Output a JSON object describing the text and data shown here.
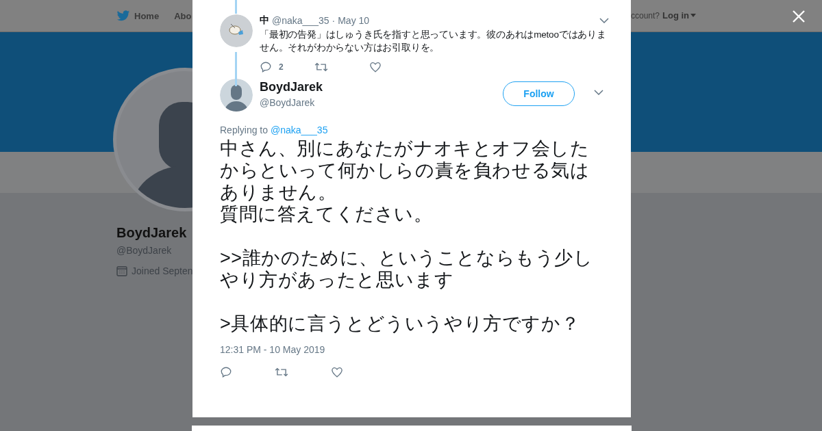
{
  "nav": {
    "links": [
      "Home",
      "Abo"
    ],
    "account_prompt": "ccount?",
    "login": "Log in"
  },
  "profile": {
    "name": "BoydJarek",
    "handle": "@BoydJarek",
    "joined": "Joined Septen"
  },
  "modal": {
    "parent_tweet": {
      "author": "中",
      "handle": "@naka___35",
      "separator": "·",
      "date": "May 10",
      "text": "「最初の告発」はしゅうき氏を指すと思っています。彼のあれはmetooではありません。それがわからない方はお引取りを。",
      "reply_count": "2"
    },
    "tweet": {
      "name": "BoydJarek",
      "handle": "@BoydJarek",
      "follow": "Follow",
      "replying_label": "Replying to",
      "replying_to": "@naka___35",
      "paragraphs": [
        [
          "中さん、別にあなたがナオキとオフ会した",
          "からといって何かしらの責を負わせる気は",
          "ありません。",
          "質問に答えてください。"
        ],
        [
          ">>誰かのために、ということならもう少し",
          "やり方があったと思います"
        ],
        [
          ">具体的に言うとどういうやり方ですか？"
        ]
      ],
      "timestamp": "12:31 PM - 10 May 2019"
    }
  }
}
